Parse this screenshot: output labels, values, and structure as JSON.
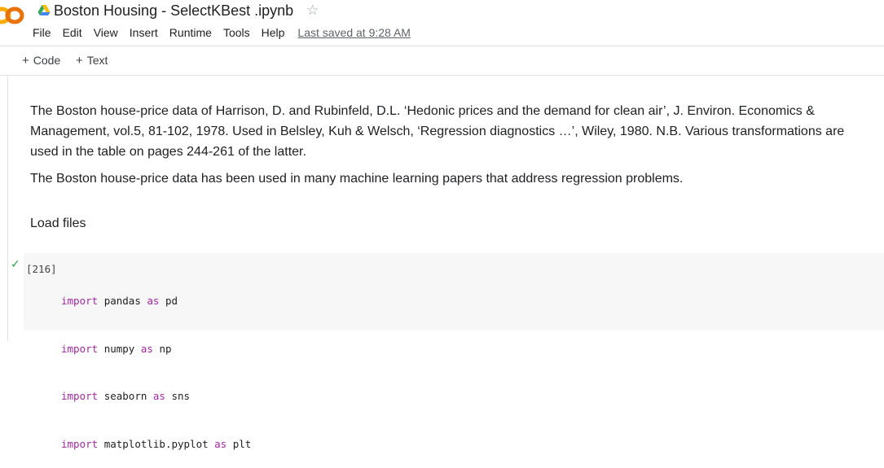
{
  "header": {
    "title": "Boston Housing - SelectKBest .ipynb",
    "menu": [
      "File",
      "Edit",
      "View",
      "Insert",
      "Runtime",
      "Tools",
      "Help"
    ],
    "last_saved": "Last saved at 9:28 AM",
    "star_icon": "star-outline-icon",
    "drive_icon": "google-drive-icon",
    "logo_icon": "colab-logo-icon",
    "colors": {
      "logo_orange": "#F9AB00",
      "logo_yellow": "#E8710A"
    }
  },
  "toolbar": {
    "add_code": "Code",
    "add_text": "Text"
  },
  "text_cell": {
    "paragraph1": "The Boston house-price data of Harrison, D. and Rubinfeld, D.L. ‘Hedonic prices and the demand for clean air’, J. Environ. Economics & Management, vol.5, 81-102, 1978. Used in Belsley, Kuh & Welsch, ‘Regression diagnostics …’, Wiley, 1980. N.B. Various transformations are used in the table on pages 244-261 of the latter.",
    "paragraph2": "The Boston house-price data has been used in many machine learning papers that address regression problems.",
    "heading": "Load files"
  },
  "code_cell": {
    "execution_count": "[216]",
    "status_icon": "checkmark-icon",
    "lines": [
      {
        "kw1": "import",
        "mod": "pandas",
        "kw2": "as",
        "alias": "pd"
      },
      {
        "kw1": "import",
        "mod": "numpy",
        "kw2": "as",
        "alias": "np"
      },
      {
        "kw1": "import",
        "mod": "seaborn",
        "kw2": "as",
        "alias": "sns"
      },
      {
        "kw1": "import",
        "mod": "matplotlib.pyplot",
        "kw2": "as",
        "alias": "plt"
      }
    ]
  }
}
